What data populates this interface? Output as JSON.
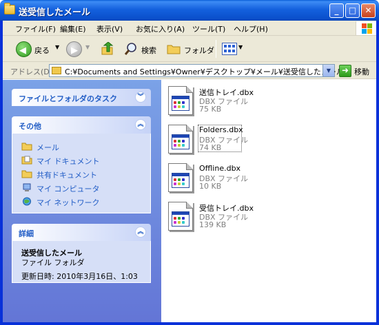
{
  "window": {
    "title": "送受信したメール"
  },
  "menu": [
    "ファイル(F)",
    "編集(E)",
    "表示(V)",
    "お気に入り(A)",
    "ツール(T)",
    "ヘルプ(H)"
  ],
  "toolbar": {
    "back_label": "戻る",
    "search_label": "検索",
    "folders_label": "フォルダ"
  },
  "address": {
    "label": "アドレス(D)",
    "path": "C:¥Documents and Settings¥Owner¥デスクトップ¥メール¥送受信したメール",
    "go_label": "移動"
  },
  "tasks": {
    "file_folder_tasks_title": "ファイルとフォルダのタスク",
    "other_places_title": "その他",
    "other_places": [
      "メール",
      "マイ ドキュメント",
      "共有ドキュメント",
      "マイ コンピュータ",
      "マイ ネットワーク"
    ],
    "details_title": "詳細",
    "details": {
      "name": "送受信したメール",
      "type": "ファイル フォルダ",
      "modified": "更新日時: 2010年3月16日、1:03"
    }
  },
  "files": [
    {
      "name": "送信トレイ.dbx",
      "type": "DBX ファイル",
      "size": "75 KB"
    },
    {
      "name": "Folders.dbx",
      "type": "DBX ファイル",
      "size": "74 KB"
    },
    {
      "name": "Offline.dbx",
      "type": "DBX ファイル",
      "size": "10 KB"
    },
    {
      "name": "受信トレイ.dbx",
      "type": "DBX ファイル",
      "size": "139 KB"
    }
  ],
  "selected_file": "Folders.dbx"
}
